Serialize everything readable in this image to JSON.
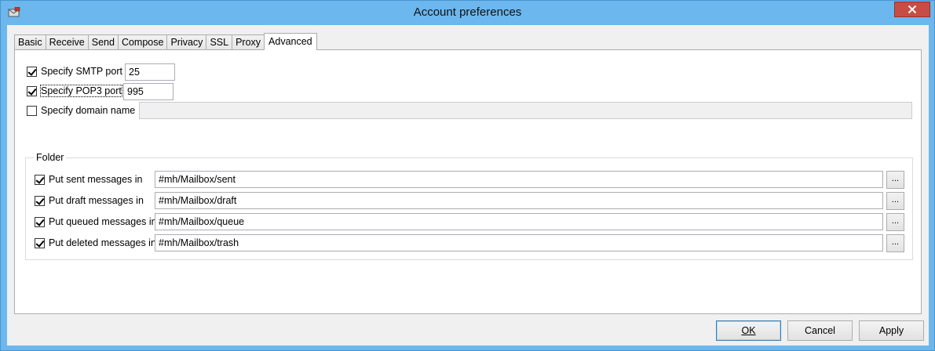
{
  "window": {
    "title": "Account preferences"
  },
  "tabs": [
    {
      "label": "Basic"
    },
    {
      "label": "Receive"
    },
    {
      "label": "Send"
    },
    {
      "label": "Compose"
    },
    {
      "label": "Privacy"
    },
    {
      "label": "SSL"
    },
    {
      "label": "Proxy"
    },
    {
      "label": "Advanced",
      "active": true
    }
  ],
  "advanced": {
    "smtp_port": {
      "label": "Specify SMTP port",
      "checked": true,
      "value": "25"
    },
    "pop3_port": {
      "label": "Specify POP3 port",
      "checked": true,
      "value": "995"
    },
    "domain_name": {
      "label": "Specify domain name",
      "checked": false,
      "value": ""
    },
    "folder": {
      "title": "Folder",
      "rows": [
        {
          "label": "Put sent messages in",
          "checked": true,
          "value": "#mh/Mailbox/sent",
          "browse": "..."
        },
        {
          "label": "Put draft messages in",
          "checked": true,
          "value": "#mh/Mailbox/draft",
          "browse": "..."
        },
        {
          "label": "Put queued messages in",
          "checked": true,
          "value": "#mh/Mailbox/queue",
          "browse": "..."
        },
        {
          "label": "Put deleted messages in",
          "checked": true,
          "value": "#mh/Mailbox/trash",
          "browse": "..."
        }
      ]
    }
  },
  "buttons": {
    "ok": "OK",
    "cancel": "Cancel",
    "apply": "Apply"
  },
  "icons": {
    "app": "app-icon",
    "close": "close-icon",
    "checkbox": "check-icon"
  },
  "colors": {
    "frame": "#6cb7ee",
    "close": "#c74d44",
    "default_button_border": "#3c7fb1"
  }
}
